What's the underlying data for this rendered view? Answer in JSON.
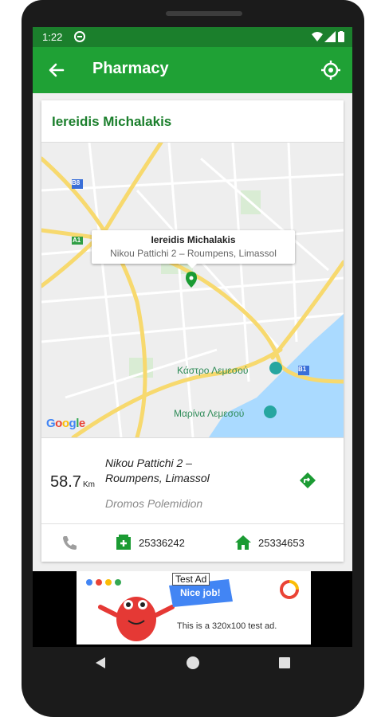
{
  "status_bar": {
    "time": "1:22"
  },
  "toolbar": {
    "title": "Pharmacy"
  },
  "pharmacy": {
    "name": "Iereidis Michalakis",
    "address": "Nikou Pattichi 2 – Roumpens, Limassol",
    "area": "Dromos Polemidion",
    "distance_value": "58.7",
    "distance_unit": "Km",
    "phone": "25336242",
    "home_phone": "25334653"
  },
  "map": {
    "info_title": "Iereidis Michalakis",
    "info_subtitle": "Nikou Pattichi 2 – Roumpens, Limassol",
    "labels": {
      "castle": "Κάστρο Λεμεσού",
      "marina": "Μαρίνα Λεμεσού",
      "b8": "B8",
      "a1": "A1",
      "b1": "B1"
    },
    "google": "Google"
  },
  "ad": {
    "badge": "Test Ad",
    "text": "This is a 320x100 test ad.",
    "banner": "Nice job!"
  },
  "colors": {
    "status_bar": "#1b7f2c",
    "toolbar": "#1fa135",
    "accent": "#1b7f2c"
  }
}
